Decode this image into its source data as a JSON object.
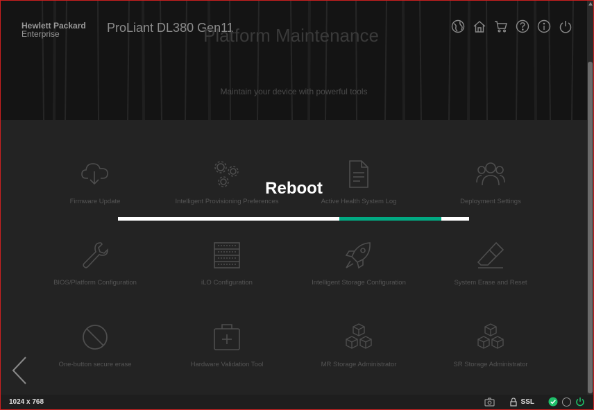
{
  "header": {
    "brand_line1": "Hewlett Packard",
    "brand_line2": "Enterprise",
    "product": "ProLiant DL380 Gen11",
    "page_title": "Platform Maintenance",
    "subtitle": "Maintain your device with powerful tools",
    "icons": [
      "globe-icon",
      "home-icon",
      "cart-icon",
      "help-icon",
      "info-icon",
      "power-icon"
    ]
  },
  "tiles": [
    {
      "label": "Firmware Update",
      "icon": "cloud-download-icon"
    },
    {
      "label": "Intelligent Provisioning Preferences",
      "icon": "gears-icon"
    },
    {
      "label": "Active Health System Log",
      "icon": "document-icon"
    },
    {
      "label": "Deployment Settings",
      "icon": "users-icon"
    },
    {
      "label": "BIOS/Platform Configuration",
      "icon": "wrench-icon"
    },
    {
      "label": "iLO Configuration",
      "icon": "server-icon"
    },
    {
      "label": "Intelligent Storage Configuration",
      "icon": "rocket-icon"
    },
    {
      "label": "System Erase and Reset",
      "icon": "eraser-icon"
    },
    {
      "label": "One-button secure erase",
      "icon": "prohibited-icon"
    },
    {
      "label": "Hardware Validation Tool",
      "icon": "medkit-icon"
    },
    {
      "label": "MR Storage Administrator",
      "icon": "cubes-icon"
    },
    {
      "label": "SR Storage Administrator",
      "icon": "cubes-icon"
    }
  ],
  "overlay": {
    "title": "Reboot",
    "progress_start": 0.63,
    "progress_end": 0.92,
    "accent": "#01a982"
  },
  "statusbar": {
    "resolution": "1024 x 768",
    "ssl": "SSL"
  }
}
